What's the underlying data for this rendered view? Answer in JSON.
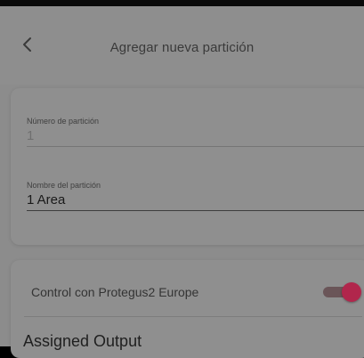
{
  "header": {
    "title": "Agregar nueva partición",
    "back_icon": "chevron-left-icon"
  },
  "form": {
    "partition_number": {
      "label": "Número de partición",
      "value": "1"
    },
    "partition_name": {
      "label": "Nombre del partición",
      "value": "1 Area"
    }
  },
  "options": {
    "protegus_control": {
      "label": "Control con Protegus2 Europe",
      "enabled": true
    },
    "assigned_output": {
      "label": "Assigned Output"
    }
  },
  "colors": {
    "accent": "#b1264c",
    "overlay_background": "#8c8c8c"
  }
}
